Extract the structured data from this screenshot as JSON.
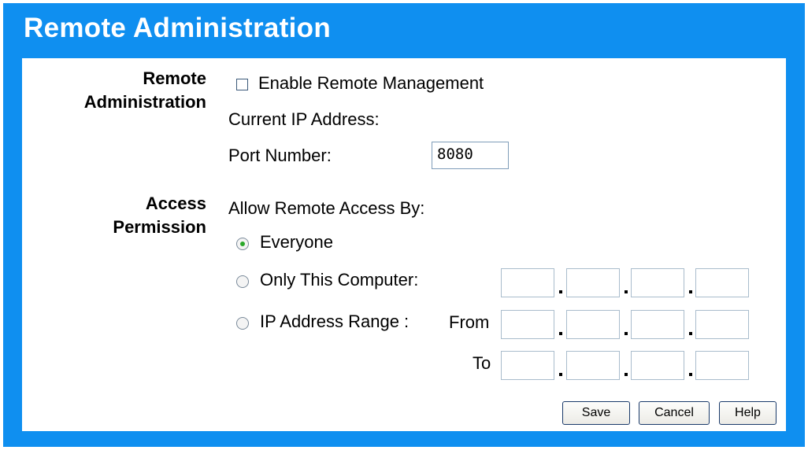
{
  "page": {
    "title": "Remote Administration"
  },
  "remote_admin": {
    "section_label_line1": "Remote",
    "section_label_line2": "Administration",
    "enable_label": "Enable Remote Management",
    "enable_checked": false,
    "current_ip_label": "Current IP Address:",
    "port_label": "Port Number:",
    "port_value": "8080"
  },
  "access": {
    "section_label_line1": "Access",
    "section_label_line2": "Permission",
    "allow_label": "Allow Remote Access By:",
    "selected": "everyone",
    "options": {
      "everyone": "Everyone",
      "only_this": "Only This Computer:",
      "ip_range": "IP Address Range :"
    },
    "from_label": "From",
    "to_label": "To"
  },
  "buttons": {
    "save": "Save",
    "cancel": "Cancel",
    "help": "Help"
  },
  "colors": {
    "frame_blue": "#0f8ff0",
    "radio_selected": "#2aa82a"
  }
}
